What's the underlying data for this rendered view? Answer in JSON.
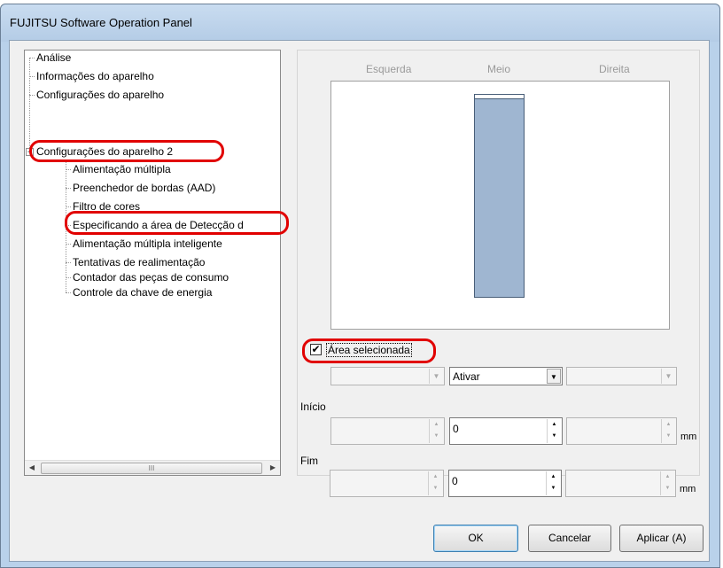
{
  "window": {
    "title": "FUJITSU Software Operation Panel"
  },
  "tree": {
    "items": [
      {
        "label": "Análise",
        "level": 0
      },
      {
        "label": "Informações do aparelho",
        "level": 0
      },
      {
        "label": "Configurações do aparelho",
        "level": 0
      },
      {
        "label": "Configurações do aparelho 2",
        "level": 0,
        "expander": "⊟"
      },
      {
        "label": "Alimentação múltipla",
        "level": 1
      },
      {
        "label": "Preenchedor de bordas (AAD)",
        "level": 1
      },
      {
        "label": "Filtro de cores",
        "level": 1
      },
      {
        "label": "Especificando a área de Detecção d",
        "level": 1,
        "selected": true
      },
      {
        "label": "Alimentação múltipla inteligente",
        "level": 1
      },
      {
        "label": "Tentativas de realimentação",
        "level": 1
      },
      {
        "label": "Contador das peças de consumo",
        "level": 1
      },
      {
        "label": "Controle da chave de energia",
        "level": 1
      }
    ],
    "scroll_thumb": "III"
  },
  "panel": {
    "columns": [
      "Esquerda",
      "Meio",
      "Direita"
    ],
    "checkbox": {
      "label": "Área selecionada",
      "checked": true,
      "mark": "✔"
    },
    "combos": [
      {
        "value": "",
        "enabled": false
      },
      {
        "value": "Ativar",
        "enabled": true
      },
      {
        "value": "",
        "enabled": false
      }
    ],
    "start": {
      "label": "Início",
      "values": [
        "",
        "0",
        ""
      ],
      "unit": "mm"
    },
    "end": {
      "label": "Fim",
      "values": [
        "",
        "0",
        ""
      ],
      "unit": "mm"
    }
  },
  "buttons": {
    "ok": "OK",
    "cancel": "Cancelar",
    "apply": "Aplicar (A)"
  },
  "colors": {
    "highlight": "#e10000",
    "area": "#9fb6d1",
    "window_frame": "#b9d1ea"
  }
}
